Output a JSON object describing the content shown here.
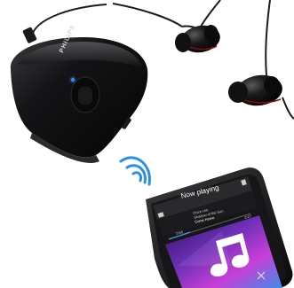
{
  "image": {
    "alt": "Philips bluetooth headset receiver with earphones streaming music wirelessly to a smartphone"
  },
  "headset": {
    "brand": "PHILIPS",
    "body_color": "#0f0f10",
    "accent_color": "#2f8fe8"
  },
  "phone": {
    "header": "Now playing",
    "artist": "Once Lee",
    "album": "Shadow of the Sun",
    "song": "Come Home",
    "elapsed": "0:56",
    "duration": "3:27",
    "album_art_colors": [
      "#2a0f5c",
      "#6b2fb5",
      "#c83fd8",
      "#3b8fe8"
    ]
  },
  "signal": {
    "color": "#2c8fe6",
    "icon": "wireless-signal-icon"
  }
}
